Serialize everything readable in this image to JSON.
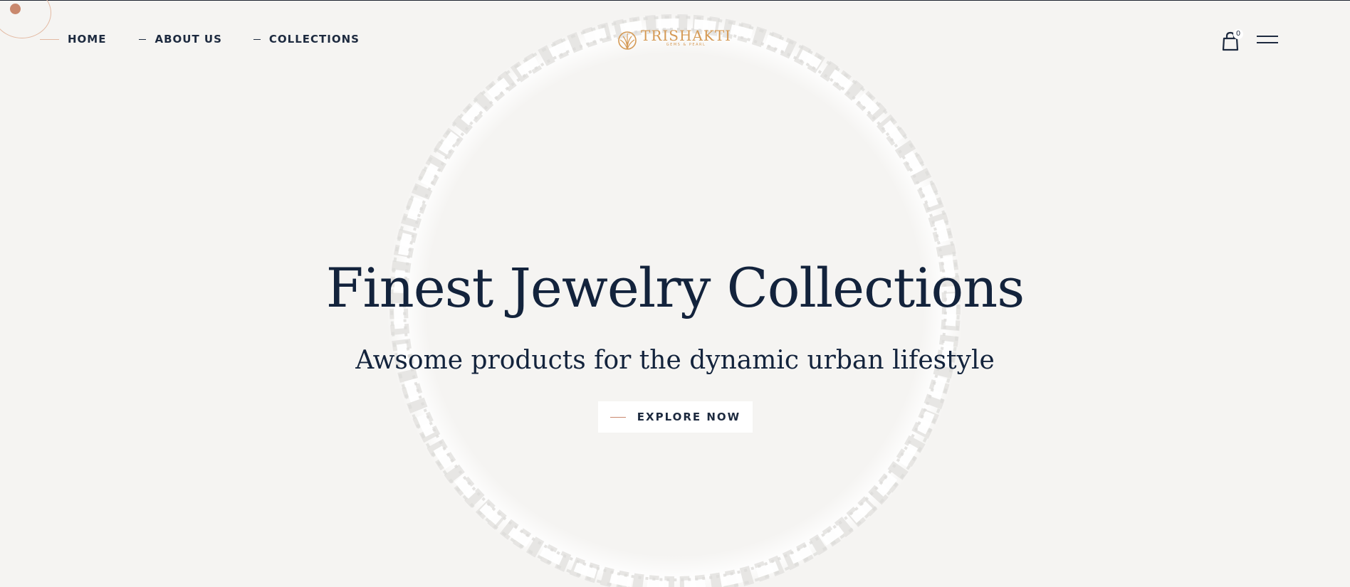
{
  "nav": {
    "items": [
      {
        "label": "HOME",
        "active": true
      },
      {
        "label": "ABOUT US",
        "active": false
      },
      {
        "label": "COLLECTIONS",
        "active": false
      }
    ]
  },
  "logo": {
    "name": "TRISHAKTI",
    "tagline": "GEMS & PEARL",
    "color": "#d59a55"
  },
  "cart": {
    "count": "0",
    "icon": "shopping-bag-icon"
  },
  "menu": {
    "icon": "hamburger-menu-icon"
  },
  "hero": {
    "title": "Finest Jewelry Collections",
    "subtitle": "Awsome products for the dynamic urban lifestyle",
    "cta_label": "EXPLORE NOW"
  },
  "colors": {
    "background": "#f5f4f2",
    "text": "#13233c",
    "accent": "#c9886d"
  }
}
